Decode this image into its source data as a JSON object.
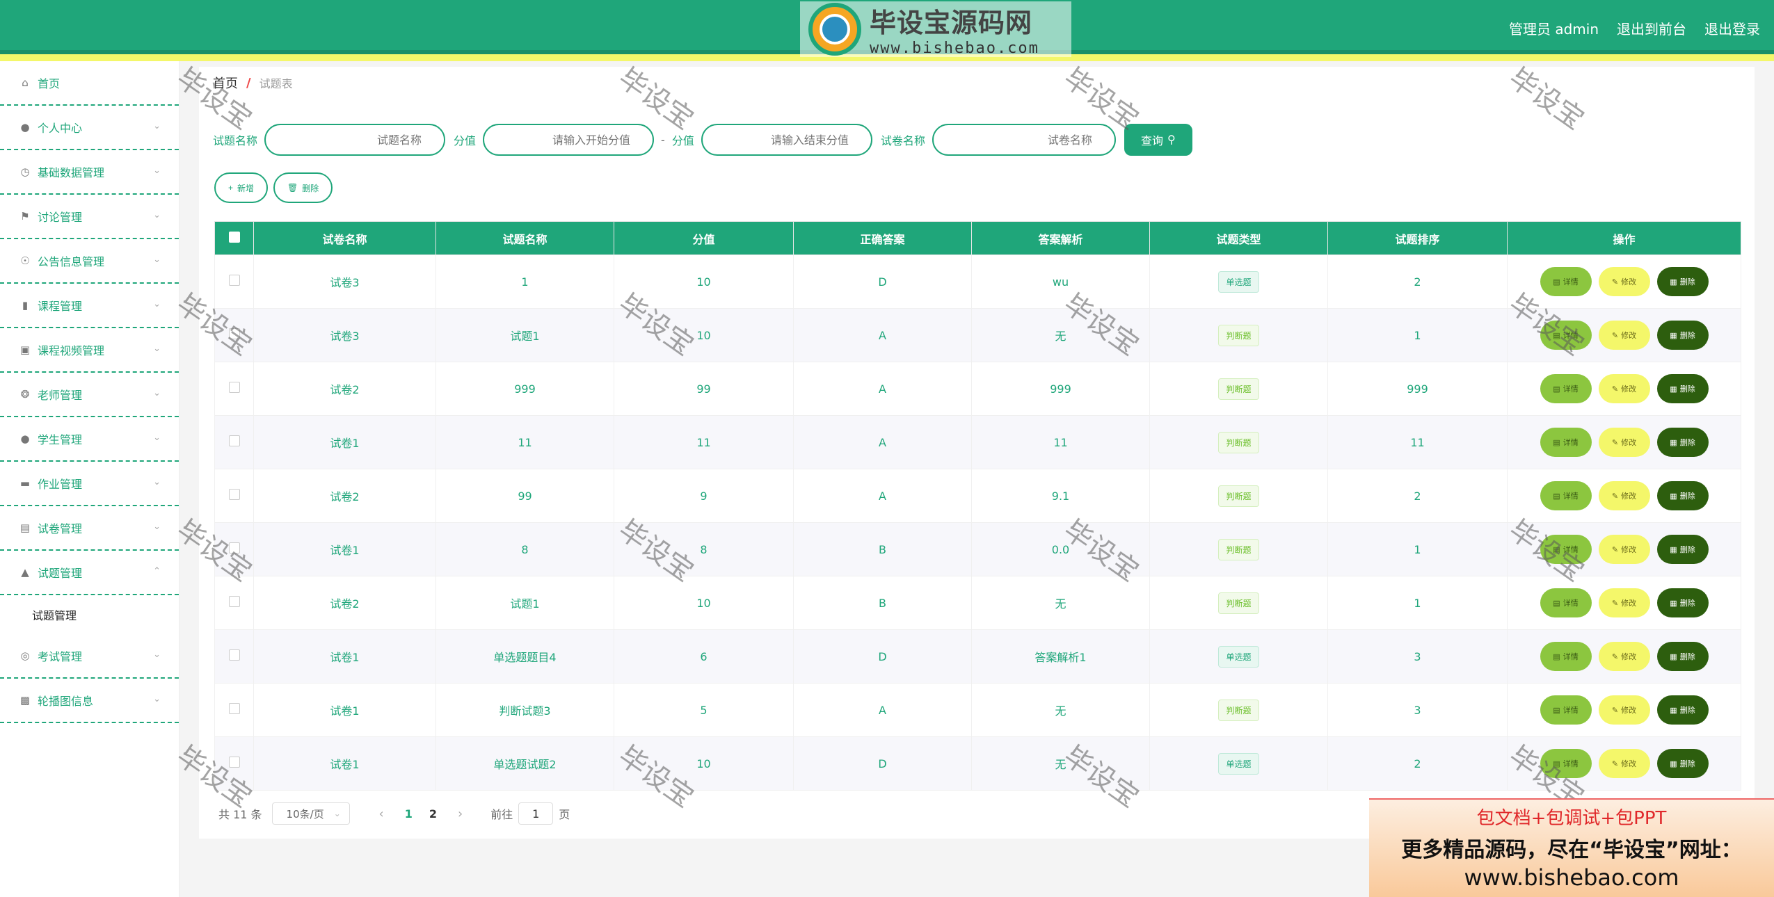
{
  "header": {
    "logo_title": "毕设宝源码网",
    "logo_url": "www.bishebao.com",
    "links": [
      "管理员 admin",
      "退出到前台",
      "退出登录"
    ]
  },
  "sidebar": {
    "items": [
      {
        "label": "首页",
        "icon": "home-icon",
        "chevron": false
      },
      {
        "label": "个人中心",
        "icon": "user-icon",
        "chevron": true
      },
      {
        "label": "基础数据管理",
        "icon": "clock-icon",
        "chevron": true
      },
      {
        "label": "讨论管理",
        "icon": "flag-icon",
        "chevron": true
      },
      {
        "label": "公告信息管理",
        "icon": "compass-icon",
        "chevron": true
      },
      {
        "label": "课程管理",
        "icon": "mic-icon",
        "chevron": true
      },
      {
        "label": "课程视频管理",
        "icon": "briefcase-icon",
        "chevron": true
      },
      {
        "label": "老师管理",
        "icon": "aperture-icon",
        "chevron": true
      },
      {
        "label": "学生管理",
        "icon": "microphone-icon",
        "chevron": true
      },
      {
        "label": "作业管理",
        "icon": "chat-icon",
        "chevron": true
      },
      {
        "label": "试卷管理",
        "icon": "clipboard-icon",
        "chevron": true
      },
      {
        "label": "试题管理",
        "icon": "stamp-icon",
        "chevron": true,
        "expanded": true
      }
    ],
    "sub_item": "试题管理",
    "items_after": [
      {
        "label": "考试管理",
        "icon": "basketball-icon",
        "chevron": true
      },
      {
        "label": "轮播图信息",
        "icon": "bar-chart-icon",
        "chevron": true
      }
    ]
  },
  "breadcrumb": {
    "home": "首页",
    "sep": "/",
    "current": "试题表"
  },
  "search": {
    "label1": "试题名称",
    "placeholder1": "试题名称",
    "label2": "分值",
    "placeholder2": "请输入开始分值",
    "dash": "-",
    "label3": "分值",
    "placeholder3": "请输入结束分值",
    "label4": "试卷名称",
    "placeholder4": "试卷名称",
    "query_label": "查询"
  },
  "actions": {
    "add": "新增",
    "delete": "删除"
  },
  "table": {
    "headers": [
      "试卷名称",
      "试题名称",
      "分值",
      "正确答案",
      "答案解析",
      "试题类型",
      "试题排序",
      "操作"
    ],
    "rows": [
      {
        "paper": "试卷3",
        "name": "1",
        "score": "10",
        "answer": "D",
        "analysis": "wu",
        "type": "单选题",
        "type_kind": "single",
        "order": "2"
      },
      {
        "paper": "试卷3",
        "name": "试题1",
        "score": "10",
        "answer": "A",
        "analysis": "无",
        "type": "判断题",
        "type_kind": "judge",
        "order": "1"
      },
      {
        "paper": "试卷2",
        "name": "999",
        "score": "99",
        "answer": "A",
        "analysis": "999",
        "type": "判断题",
        "type_kind": "judge",
        "order": "999"
      },
      {
        "paper": "试卷1",
        "name": "11",
        "score": "11",
        "answer": "A",
        "analysis": "11",
        "type": "判断题",
        "type_kind": "judge",
        "order": "11"
      },
      {
        "paper": "试卷2",
        "name": "99",
        "score": "9",
        "answer": "A",
        "analysis": "9.1",
        "type": "判断题",
        "type_kind": "judge",
        "order": "2"
      },
      {
        "paper": "试卷1",
        "name": "8",
        "score": "8",
        "answer": "B",
        "analysis": "0.0",
        "type": "判断题",
        "type_kind": "judge",
        "order": "1"
      },
      {
        "paper": "试卷2",
        "name": "试题1",
        "score": "10",
        "answer": "B",
        "analysis": "无",
        "type": "判断题",
        "type_kind": "judge",
        "order": "1"
      },
      {
        "paper": "试卷1",
        "name": "单选题题目4",
        "score": "6",
        "answer": "D",
        "analysis": "答案解析1",
        "type": "单选题",
        "type_kind": "single",
        "order": "3"
      },
      {
        "paper": "试卷1",
        "name": "判断试题3",
        "score": "5",
        "answer": "A",
        "analysis": "无",
        "type": "判断题",
        "type_kind": "judge",
        "order": "3"
      },
      {
        "paper": "试卷1",
        "name": "单选题试题2",
        "score": "10",
        "answer": "D",
        "analysis": "无",
        "type": "单选题",
        "type_kind": "single",
        "order": "2"
      }
    ],
    "op_labels": {
      "detail": "详情",
      "edit": "修改",
      "del": "删除"
    }
  },
  "pager": {
    "total": "共 11 条",
    "size": "10条/页",
    "pages": [
      "1",
      "2"
    ],
    "goto_prefix": "前往",
    "goto_value": "1",
    "goto_suffix": "页"
  },
  "watermark": "毕设宝",
  "promo": {
    "line1": "包文档+包调试+包PPT",
    "line2": "更多精品源码，尽在“毕设宝”网址：",
    "line3": "www.bishebao.com"
  },
  "colors": {
    "primary": "#1fa67a",
    "accent_yellow": "#f4f76a",
    "detail": "#8cc63f",
    "delete": "#2d5e0e"
  }
}
